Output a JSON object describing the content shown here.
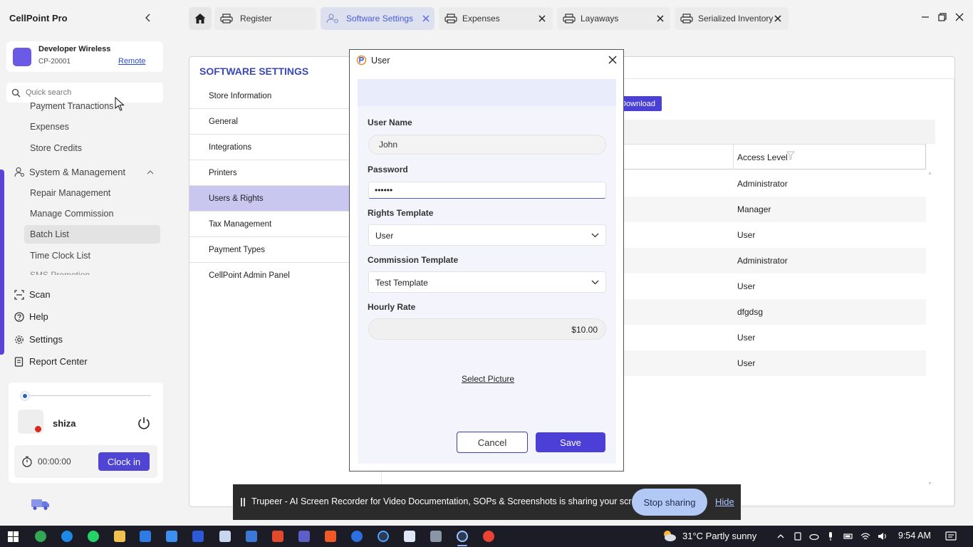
{
  "app": {
    "title": "CellPoint Pro"
  },
  "store": {
    "name": "Developer Wireless",
    "code": "CP-20001",
    "remote_label": "Remote"
  },
  "search": {
    "placeholder": "Quick search"
  },
  "nav": {
    "sub_items_top": [
      "Payment Tranactions",
      "Expenses",
      "Store Credits"
    ],
    "section": "System & Management",
    "sub_items": [
      "Repair Management",
      "Manage Commission",
      "Batch List",
      "Time Clock List"
    ],
    "clipped_item": "SMS Promotion",
    "main_items": [
      "Scan",
      "Help",
      "Settings",
      "Report Center"
    ]
  },
  "user": {
    "name": "shiza",
    "clock_time": "00:00:00",
    "clock_in_label": "Clock in"
  },
  "tabs": [
    {
      "label": "Register",
      "icon": "printer-icon",
      "active": false
    },
    {
      "label": "Software Settings",
      "icon": "settings-user-icon",
      "active": true
    },
    {
      "label": "Expenses",
      "icon": "printer-icon",
      "active": false
    },
    {
      "label": "Layaways",
      "icon": "printer-icon",
      "active": false
    },
    {
      "label": "Serialized Inventory",
      "icon": "printer-icon",
      "active": false
    }
  ],
  "settings": {
    "title": "SOFTWARE SETTINGS",
    "menu": [
      "Store Information",
      "General",
      "Integrations",
      "Printers",
      "Users & Rights",
      "Tax Management",
      "Payment Types",
      "CellPoint Admin Panel"
    ],
    "selected": "Users & Rights"
  },
  "table": {
    "download_label": "Download",
    "access_header": "Access Level",
    "access_levels": [
      "Administrator",
      "Manager",
      "User",
      "Administrator",
      "User",
      "dfgdsg",
      "User",
      "User"
    ]
  },
  "dialog": {
    "title": "User",
    "username_label": "User Name",
    "username_value": "John",
    "password_label": "Password",
    "password_value": "••••••",
    "rights_label": "Rights Template",
    "rights_value": "User",
    "commission_label": "Commission Template",
    "commission_value": "Test Template",
    "rate_label": "Hourly Rate",
    "rate_value": "$10.00",
    "select_picture": "Select Picture",
    "cancel": "Cancel",
    "save": "Save"
  },
  "share_bar": {
    "text": "Trupeer - AI Screen Recorder for Video Documentation, SOPs & Screenshots is sharing your screen.",
    "stop_label": "Stop sharing",
    "hide_label": "Hide"
  },
  "taskbar": {
    "weather": "31°C  Partly sunny",
    "time": "9:54 AM"
  },
  "colors": {
    "accent": "#4b3fd8",
    "title_blue": "#3b48b8",
    "selected_menu": "#c9c6ef"
  }
}
